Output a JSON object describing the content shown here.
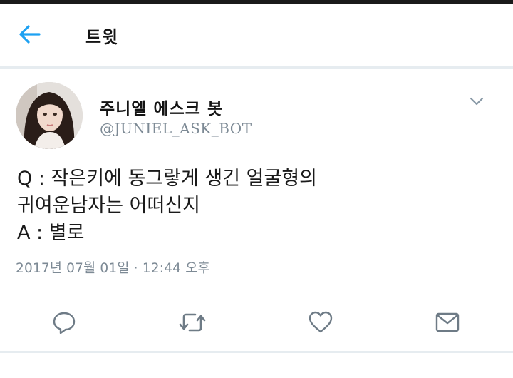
{
  "header": {
    "title": "트윗",
    "back_icon": "arrow-left-icon",
    "accent_color": "#1da1f2"
  },
  "tweet": {
    "display_name": "주니엘 에스크 봇",
    "handle": "@JUNIEL_ASK_BOT",
    "text_lines": [
      "Q : 작은키에 동그랗게 생긴 얼굴형의",
      "귀여운남자는 어떠신지",
      "A : 별로"
    ],
    "timestamp": "2017년 07월 01일 · 12:44 오후"
  },
  "actions": [
    {
      "icon": "reply-icon"
    },
    {
      "icon": "retweet-icon"
    },
    {
      "icon": "like-icon"
    },
    {
      "icon": "message-icon"
    }
  ]
}
